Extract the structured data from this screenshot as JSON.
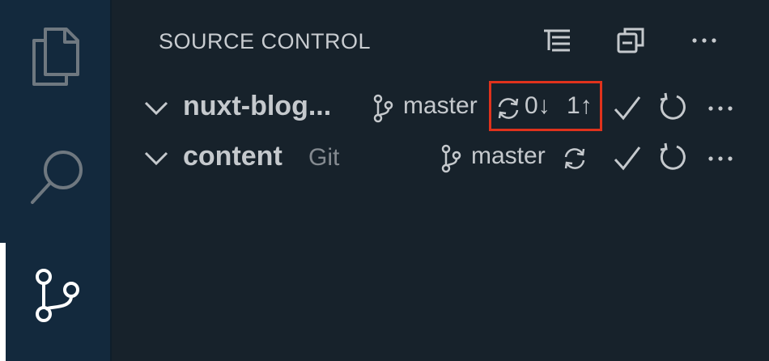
{
  "activity_bar": {
    "items": [
      {
        "name": "explorer",
        "icon": "files-icon"
      },
      {
        "name": "search",
        "icon": "search-icon"
      },
      {
        "name": "source-control",
        "icon": "source-control-icon",
        "active": true
      }
    ]
  },
  "sidebar": {
    "title": "SOURCE CONTROL",
    "header_actions": [
      {
        "icon": "view-as-tree-icon"
      },
      {
        "icon": "collapse-all-icon"
      },
      {
        "icon": "more-actions-icon"
      }
    ]
  },
  "repositories": [
    {
      "name": "nuxt-blog...",
      "provider": "",
      "branch": "master",
      "sync": {
        "incoming": "0↓",
        "outgoing": "1↑"
      }
    },
    {
      "name": "content",
      "provider": "Git",
      "branch": "master",
      "sync": {
        "incoming": "",
        "outgoing": ""
      }
    }
  ],
  "colors": {
    "highlight": "#e0321c",
    "activity_bar_bg": "#13293d",
    "sidebar_bg": "#17222b"
  }
}
